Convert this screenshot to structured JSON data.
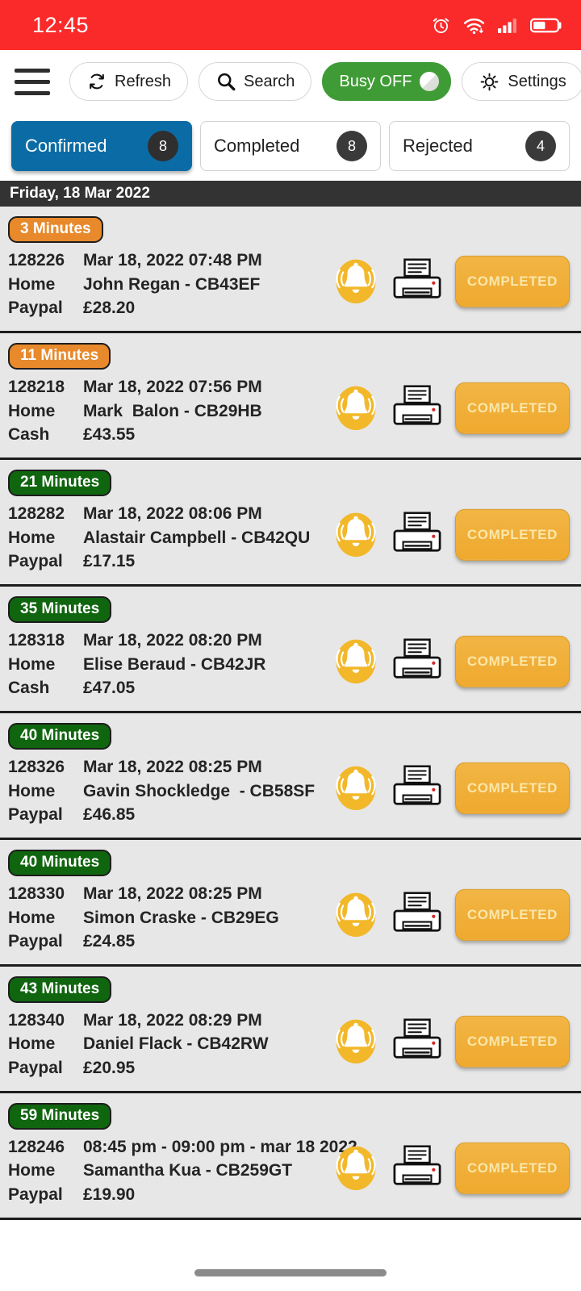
{
  "status_bar": {
    "time": "12:45",
    "background": "#FA2A2A",
    "icons": [
      "alarm-icon",
      "wifi-icon",
      "signal-icon",
      "battery-icon"
    ]
  },
  "toolbar": {
    "menu_icon": "hamburger-menu-icon",
    "refresh_label": "Refresh",
    "refresh_icon": "refresh-icon",
    "search_label": "Search",
    "search_icon": "search-icon",
    "busy_label": "Busy OFF",
    "busy_state": "off",
    "busy_color": "#3F9B35",
    "settings_label": "Settings",
    "settings_icon": "gear-icon"
  },
  "tabs": [
    {
      "label": "Confirmed",
      "count": "8",
      "active": true
    },
    {
      "label": "Completed",
      "count": "8",
      "active": false
    },
    {
      "label": "Rejected",
      "count": "4",
      "active": false
    }
  ],
  "active_tab_color": "#0B6CA5",
  "date_header": "Friday, 18 Mar 2022",
  "orders": [
    {
      "badge": "3 Minutes",
      "badge_color": "orange",
      "id": "128226",
      "type": "Home",
      "payment": "Paypal",
      "datetime": "Mar 18, 2022 07:48 PM",
      "customer": "John Regan - CB43EF",
      "amount": "£28.20",
      "action_label": "COMPLETED"
    },
    {
      "badge": "11 Minutes",
      "badge_color": "orange",
      "id": "128218",
      "type": "Home",
      "payment": "Cash",
      "datetime": "Mar 18, 2022 07:56 PM",
      "customer": "Mark  Balon - CB29HB",
      "amount": "£43.55",
      "action_label": "COMPLETED"
    },
    {
      "badge": "21 Minutes",
      "badge_color": "green",
      "id": "128282",
      "type": "Home",
      "payment": "Paypal",
      "datetime": "Mar 18, 2022 08:06 PM",
      "customer": "Alastair Campbell - CB42QU",
      "amount": "£17.15",
      "action_label": "COMPLETED"
    },
    {
      "badge": "35 Minutes",
      "badge_color": "green",
      "id": "128318",
      "type": "Home",
      "payment": "Cash",
      "datetime": "Mar 18, 2022 08:20 PM",
      "customer": "Elise Beraud - CB42JR",
      "amount": "£47.05",
      "action_label": "COMPLETED"
    },
    {
      "badge": "40 Minutes",
      "badge_color": "green",
      "id": "128326",
      "type": "Home",
      "payment": "Paypal",
      "datetime": "Mar 18, 2022 08:25 PM",
      "customer": "Gavin Shockledge  - CB58SF",
      "amount": "£46.85",
      "action_label": "COMPLETED"
    },
    {
      "badge": "40 Minutes",
      "badge_color": "green",
      "id": "128330",
      "type": "Home",
      "payment": "Paypal",
      "datetime": "Mar 18, 2022 08:25 PM",
      "customer": "Simon Craske - CB29EG",
      "amount": "£24.85",
      "action_label": "COMPLETED"
    },
    {
      "badge": "43 Minutes",
      "badge_color": "green",
      "id": "128340",
      "type": "Home",
      "payment": "Paypal",
      "datetime": "Mar 18, 2022 08:29 PM",
      "customer": "Daniel Flack - CB42RW",
      "amount": "£20.95",
      "action_label": "COMPLETED"
    },
    {
      "badge": "59 Minutes",
      "badge_color": "green",
      "id": "128246",
      "type": "Home",
      "payment": "Paypal",
      "datetime": "08:45 pm - 09:00 pm - mar 18 2022",
      "customer": "Samantha Kua - CB259GT",
      "amount": "£19.90",
      "action_label": "COMPLETED"
    }
  ],
  "row_icons": {
    "bell": "bell-icon",
    "printer": "printer-icon"
  },
  "bottom_nav": {
    "home_indicator": "home-indicator"
  }
}
